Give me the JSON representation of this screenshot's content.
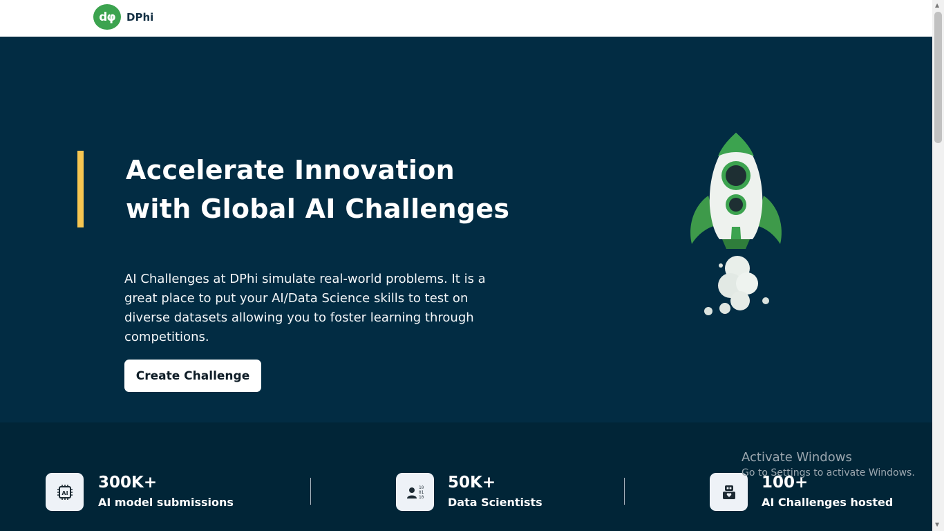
{
  "brand": {
    "logo_glyph": "dφ",
    "name": "DPhi",
    "color": "#3ca34f"
  },
  "hero": {
    "title_line1": "Accelerate Innovation",
    "title_line2": "with Global AI Challenges",
    "description": "AI Challenges at DPhi simulate real-world problems. It is a great place to put your AI/Data Science skills to test on diverse datasets allowing you to foster learning through competitions.",
    "cta_label": "Create Challenge",
    "illustration": "rocket-icon",
    "accent_color": "#f6c651",
    "background": "#022c43"
  },
  "stats": [
    {
      "value": "300K+",
      "label": "AI model submissions",
      "icon": "ai-chip-icon"
    },
    {
      "value": "50K+",
      "label": "Data Scientists",
      "icon": "data-scientist-icon"
    },
    {
      "value": "100+",
      "label": "AI Challenges hosted",
      "icon": "robot-icon"
    }
  ],
  "watermark": {
    "title": "Activate Windows",
    "subtitle": "Go to Settings to activate Windows."
  }
}
